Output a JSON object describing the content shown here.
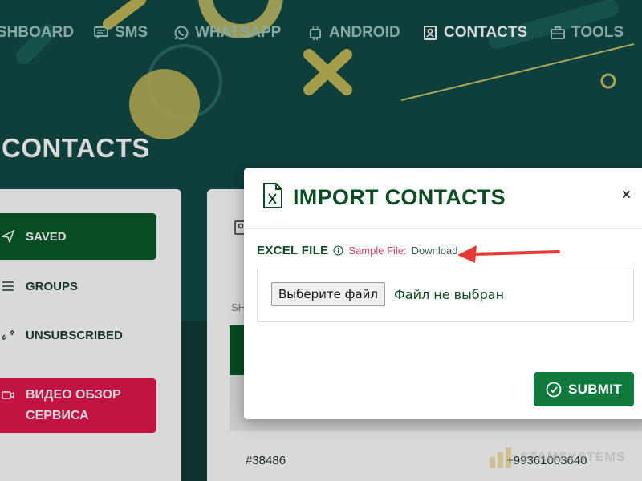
{
  "nav": {
    "items": [
      {
        "label": "SHBOARD",
        "icon": "dashboard-icon"
      },
      {
        "label": "SMS",
        "icon": "message-icon"
      },
      {
        "label": "WHATSAPP",
        "icon": "whatsapp-icon"
      },
      {
        "label": "ANDROID",
        "icon": "android-icon"
      },
      {
        "label": "CONTACTS",
        "icon": "contacts-icon",
        "active": true
      },
      {
        "label": "TOOLS",
        "icon": "toolbox-icon"
      }
    ]
  },
  "page": {
    "title": "CONTACTS"
  },
  "sidebar": {
    "items": [
      {
        "label": "SAVED",
        "icon": "send-icon"
      },
      {
        "label": "GROUPS",
        "icon": "list-icon"
      },
      {
        "label": "UNSUBSCRIBED",
        "icon": "unlink-icon"
      }
    ],
    "video": {
      "line1": "ВИДЕО ОБЗОР",
      "line2": "СЕРВИСА",
      "icon": "video-icon"
    }
  },
  "main": {
    "short_label": "SH",
    "row": {
      "id": "#38486",
      "phone": "+99361003640"
    }
  },
  "modal": {
    "title": "IMPORT CONTACTS",
    "close": "×",
    "field_label": "EXCEL FILE",
    "sample_label": "Sample File:",
    "download_label": "Download",
    "file_button": "Выберите файл",
    "file_status": "Файл не выбран",
    "submit_label": "SUBMIT"
  },
  "watermark": {
    "text": "STAMSYSTEMS"
  },
  "colors": {
    "accent_green": "#0b4d22",
    "submit_green": "#0f7a3b",
    "saved_green": "#0a5a2a",
    "video_red": "#e6174f",
    "sample_red": "#e03a5f",
    "background_teal": "#114b45"
  }
}
